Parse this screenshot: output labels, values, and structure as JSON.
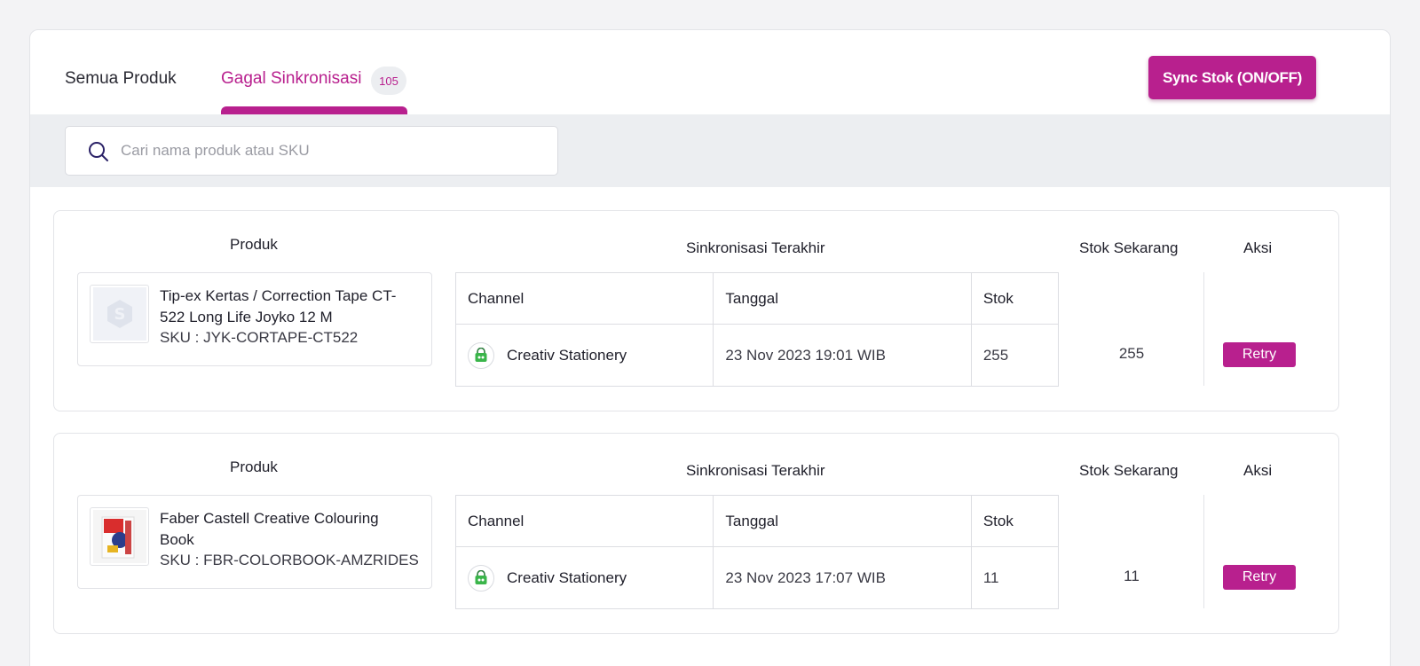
{
  "tabs": {
    "all_label": "Semua Produk",
    "failed_label": "Gagal Sinkronisasi",
    "failed_count": "105"
  },
  "actions": {
    "sync_label": "Sync Stok (ON/OFF)"
  },
  "search": {
    "placeholder": "Cari nama produk atau SKU"
  },
  "columns": {
    "produk": "Produk",
    "sinkronisasi": "Sinkronisasi Terakhir",
    "stok_sekarang": "Stok Sekarang",
    "aksi": "Aksi",
    "channel": "Channel",
    "tanggal": "Tanggal",
    "stok": "Stok"
  },
  "products": [
    {
      "name": "Tip-ex Kertas / Correction Tape CT-522 Long Life Joyko 12 M",
      "sku": "SKU : JYK-CORTAPE-CT522",
      "thumbnail": "placeholder-logo",
      "channel": "Creativ Stationery",
      "channel_icon": "shop-bag-icon",
      "date": "23 Nov 2023 19:01 WIB",
      "stok": "255",
      "stok_now": "255",
      "retry_label": "Retry"
    },
    {
      "name": "Faber Castell Creative Colouring Book",
      "sku": "SKU : FBR-COLORBOOK-AMZRIDES",
      "thumbnail": "colouring-book-photo",
      "channel": "Creativ Stationery",
      "channel_icon": "shop-bag-icon",
      "date": "23 Nov 2023 17:07 WIB",
      "stok": "11",
      "stok_now": "11",
      "retry_label": "Retry"
    }
  ],
  "colors": {
    "accent": "#b8208e",
    "search_band": "#eceef1"
  }
}
